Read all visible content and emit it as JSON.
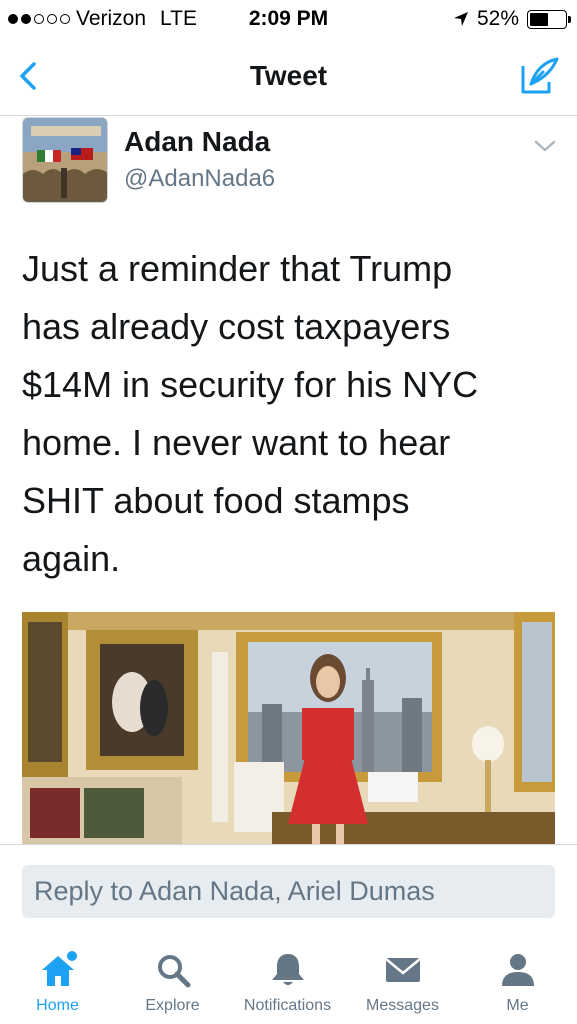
{
  "status_bar": {
    "carrier": "Verizon",
    "network": "LTE",
    "time": "2:09 PM",
    "battery_percent": "52%",
    "battery_level": 0.52,
    "signal_bars": 2,
    "signal_total": 5
  },
  "nav": {
    "title": "Tweet",
    "back_icon": "chevron-left-icon",
    "compose_icon": "compose-tweet-icon"
  },
  "tweet": {
    "display_name": "Adan Nada",
    "handle": "@AdanNada6",
    "lines": [
      "Just a reminder that Trump",
      "has already cost taxpayers",
      "$14M in security for his NYC",
      "home. I never want to hear",
      "SHIT about food stamps",
      "again."
    ]
  },
  "reply": {
    "placeholder": "Reply to Adan Nada, Ariel Dumas"
  },
  "tabs": [
    {
      "label": "Home",
      "icon": "home-icon",
      "active": true
    },
    {
      "label": "Explore",
      "icon": "search-icon",
      "active": false
    },
    {
      "label": "Notifications",
      "icon": "bell-icon",
      "active": false
    },
    {
      "label": "Messages",
      "icon": "envelope-icon",
      "active": false
    },
    {
      "label": "Me",
      "icon": "person-icon",
      "active": false
    }
  ],
  "colors": {
    "accent": "#1da1f2",
    "text": "#14171a",
    "muted": "#657786",
    "reply_bg": "#e6ecf0"
  }
}
